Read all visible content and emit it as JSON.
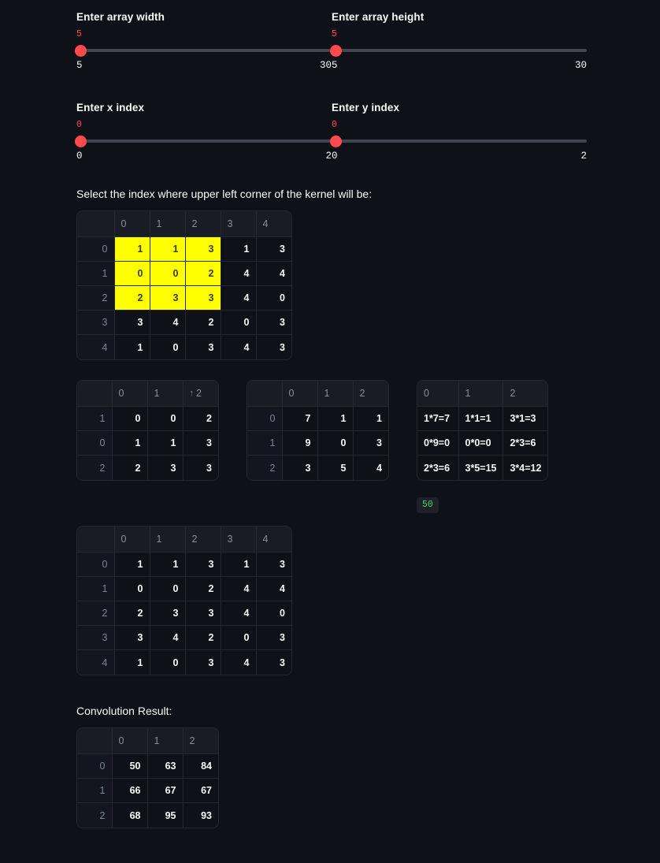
{
  "sliders": [
    {
      "label": "Enter array width",
      "value": "5",
      "min": "5",
      "max": "30",
      "fill_pct": 0
    },
    {
      "label": "Enter array height",
      "value": "5",
      "min": "5",
      "max": "30",
      "fill_pct": 0
    },
    {
      "label": "Enter x index",
      "value": "0",
      "min": "0",
      "max": "2",
      "fill_pct": 0
    },
    {
      "label": "Enter y index",
      "value": "0",
      "min": "0",
      "max": "2",
      "fill_pct": 0
    }
  ],
  "captions": {
    "kernel_position": "Select the index where upper left corner of the kernel will be:",
    "convolution_result": "Convolution Result:"
  },
  "input_array_highlighted": {
    "columns": [
      "0",
      "1",
      "2",
      "3",
      "4"
    ],
    "row_index": [
      "0",
      "1",
      "2",
      "3",
      "4"
    ],
    "rows": [
      [
        "1",
        "1",
        "3",
        "1",
        "3"
      ],
      [
        "0",
        "0",
        "2",
        "4",
        "4"
      ],
      [
        "2",
        "3",
        "3",
        "4",
        "0"
      ],
      [
        "3",
        "4",
        "2",
        "0",
        "3"
      ],
      [
        "1",
        "0",
        "3",
        "4",
        "3"
      ]
    ],
    "highlight": {
      "row_start": 0,
      "row_end": 2,
      "col_start": 0,
      "col_end": 2,
      "color": "#ffff00"
    }
  },
  "kernel_window": {
    "columns": [
      "0",
      "1",
      "2"
    ],
    "sorted_column": "2",
    "sort_direction": "ascending",
    "row_index": [
      "1",
      "0",
      "2"
    ],
    "rows": [
      [
        "0",
        "0",
        "2"
      ],
      [
        "1",
        "1",
        "3"
      ],
      [
        "2",
        "3",
        "3"
      ]
    ]
  },
  "kernel": {
    "columns": [
      "0",
      "1",
      "2"
    ],
    "row_index": [
      "0",
      "1",
      "2"
    ],
    "rows": [
      [
        "7",
        "1",
        "1"
      ],
      [
        "9",
        "0",
        "3"
      ],
      [
        "3",
        "5",
        "4"
      ]
    ]
  },
  "products": {
    "columns": [
      "0",
      "1",
      "2"
    ],
    "rows": [
      [
        "1*7=7",
        "1*1=1",
        "3*1=3"
      ],
      [
        "0*9=0",
        "0*0=0",
        "2*3=6"
      ],
      [
        "2*3=6",
        "3*5=15",
        "3*4=12"
      ]
    ]
  },
  "sum_badge": "50",
  "input_array_plain": {
    "columns": [
      "0",
      "1",
      "2",
      "3",
      "4"
    ],
    "row_index": [
      "0",
      "1",
      "2",
      "3",
      "4"
    ],
    "rows": [
      [
        "1",
        "1",
        "3",
        "1",
        "3"
      ],
      [
        "0",
        "0",
        "2",
        "4",
        "4"
      ],
      [
        "2",
        "3",
        "3",
        "4",
        "0"
      ],
      [
        "3",
        "4",
        "2",
        "0",
        "3"
      ],
      [
        "1",
        "0",
        "3",
        "4",
        "3"
      ]
    ]
  },
  "convolution_result": {
    "columns": [
      "0",
      "1",
      "2"
    ],
    "row_index": [
      "0",
      "1",
      "2"
    ],
    "rows": [
      [
        "50",
        "63",
        "84"
      ],
      [
        "66",
        "67",
        "67"
      ],
      [
        "68",
        "95",
        "93"
      ]
    ]
  },
  "colors": {
    "background": "#0e1117",
    "text": "#fafafa",
    "accent": "#ff4b4b",
    "highlight": "#ffff00",
    "code_green": "#4ad17a",
    "border": "#262730",
    "header_bg": "#1a1c24"
  }
}
